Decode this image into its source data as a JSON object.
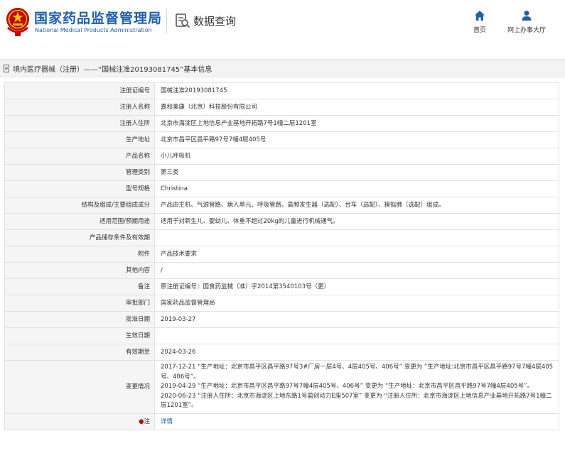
{
  "header": {
    "org_name_cn": "国家药品监督管理局",
    "org_name_en": "National Medical Products Administration",
    "query_label": "数据查询",
    "nav": [
      {
        "label": "首页",
        "icon": "home-icon"
      },
      {
        "label": "网上办事大厅",
        "icon": "user-icon"
      }
    ]
  },
  "title": "境内医疗器械（注册）——“国械注准20193081745”基本信息",
  "rows": [
    {
      "label": "注册证编号",
      "value": "国械注准20193081745"
    },
    {
      "label": "注册人名称",
      "value": "嘉和美康（北京）科技股份有限公司"
    },
    {
      "label": "注册人住所",
      "value": "北京市海淀区上地信息产业基地开拓路7号1幢二层1201室"
    },
    {
      "label": "生产地址",
      "value": "北京市昌平区昌平路97号7幢4层405号"
    },
    {
      "label": "产品名称",
      "value": "小儿呼吸机"
    },
    {
      "label": "管理类别",
      "value": "第三类"
    },
    {
      "label": "型号规格",
      "value": "Christina"
    },
    {
      "label": "结构及组成/主要组成成分",
      "value": "产品由主机、气源管路、病人单元、呼吸管路、高频发生器（选配）、台车（选配）、模拟肺（选配）组成。"
    },
    {
      "label": "适用范围/预期用途",
      "value": "适用于对新生儿、婴幼儿、体重不超过20kg的儿童进行机械通气。"
    },
    {
      "label": "产品储存条件及有效期",
      "value": ""
    },
    {
      "label": "附件",
      "value": "产品技术要求"
    },
    {
      "label": "其他内容",
      "value": "/"
    },
    {
      "label": "备注",
      "value": "原注册证编号：国食药监械（准）字2014第3540103号（更）"
    },
    {
      "label": "审批部门",
      "value": "国家药品监督管理局"
    },
    {
      "label": "批准日期",
      "value": "2019-03-27"
    },
    {
      "label": "生效日期",
      "value": ""
    },
    {
      "label": "有效期至",
      "value": "2024-03-26"
    }
  ],
  "changes": {
    "label": "变更情况",
    "items": [
      "2017-12-21 “生产地址：北京市昌平区昌平路97号3#厂房一层4号、4层405号、406号” 变更为 “生产地址:北京市昌平区昌平路97号7幢4层405号、406号”。",
      "2019-04-29 “生产地址：北京市昌平区昌平路97号7幢4层405号、406号” 变更为 “生产地址：北京市昌平区昌平路97号7幢4层405号”。",
      "2020-06-23 “注册人住所：北京市海淀区上地东路1号盈创动力E座507室” 变更为 “注册人住所：北京市海淀区上地信息产业基地开拓路7号1幢二层1201室”。"
    ]
  },
  "note_row": {
    "star": "●",
    "label": "注",
    "link": "详情"
  },
  "colors": {
    "brand_blue": "#1f5fa9",
    "logo_red": "#c30000",
    "label_bg": "#f5f5f5",
    "border": "#e2e2e2"
  }
}
